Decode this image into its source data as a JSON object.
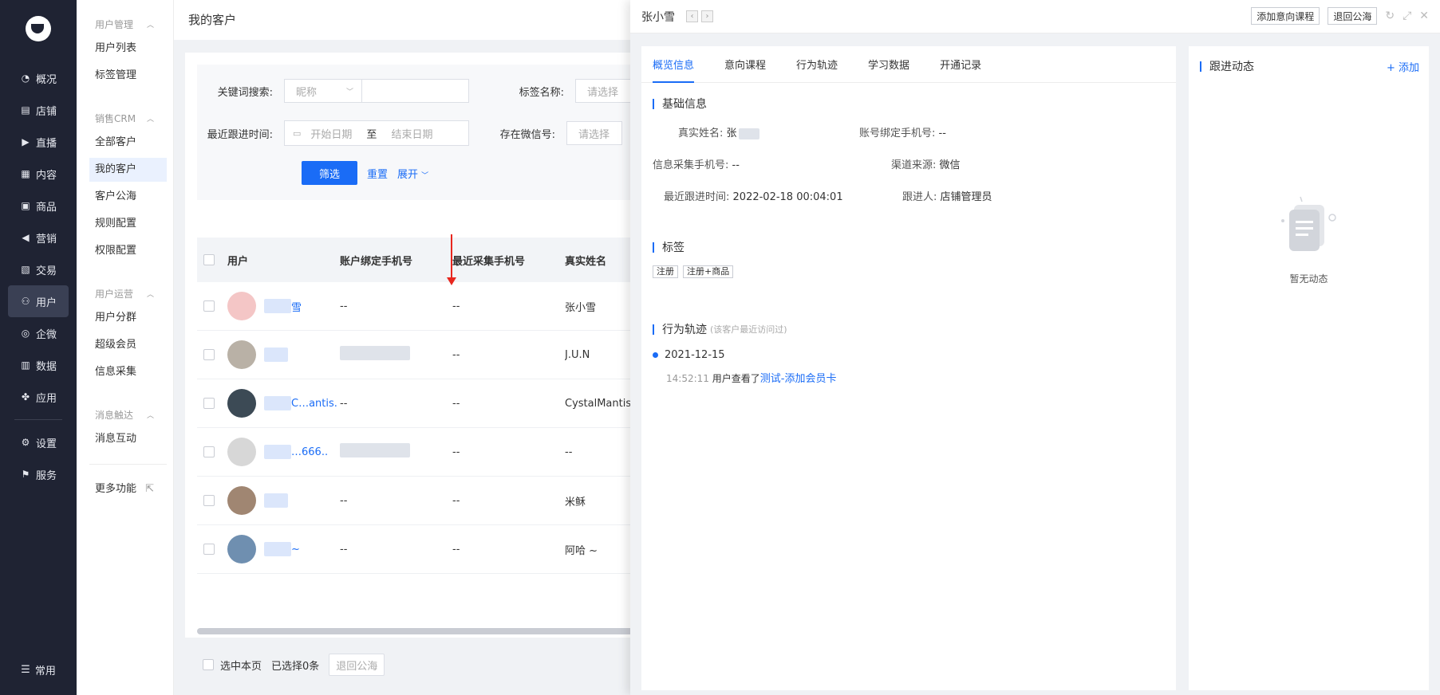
{
  "nav": {
    "items": [
      {
        "label": "概况",
        "icon": "dashboard-icon",
        "glyph": "◔"
      },
      {
        "label": "店铺",
        "icon": "store-icon",
        "glyph": "▤"
      },
      {
        "label": "直播",
        "icon": "live-icon",
        "glyph": "▶"
      },
      {
        "label": "内容",
        "icon": "content-icon",
        "glyph": "▦"
      },
      {
        "label": "商品",
        "icon": "goods-icon",
        "glyph": "▣"
      },
      {
        "label": "营销",
        "icon": "marketing-icon",
        "glyph": "◀"
      },
      {
        "label": "交易",
        "icon": "trade-icon",
        "glyph": "▧"
      },
      {
        "label": "用户",
        "icon": "user-icon",
        "glyph": "⚇"
      },
      {
        "label": "企微",
        "icon": "wecom-icon",
        "glyph": "◎"
      },
      {
        "label": "数据",
        "icon": "data-icon",
        "glyph": "▥"
      },
      {
        "label": "应用",
        "icon": "apps-icon",
        "glyph": "✤"
      }
    ],
    "items2": [
      {
        "label": "设置",
        "icon": "settings-icon",
        "glyph": "⚙"
      },
      {
        "label": "服务",
        "icon": "service-icon",
        "glyph": "⚑"
      }
    ],
    "bottom_label": "常用"
  },
  "sub": {
    "group1": "用户管理",
    "g1items": [
      "用户列表",
      "标签管理"
    ],
    "group2": "销售CRM",
    "g2items": [
      "全部客户",
      "我的客户",
      "客户公海",
      "规则配置",
      "权限配置"
    ],
    "group3": "用户运营",
    "g3items": [
      "用户分群",
      "超级会员",
      "信息采集"
    ],
    "group4": "消息触达",
    "g4items": [
      "消息互动"
    ],
    "more": "更多功能"
  },
  "page": {
    "title": "我的客户",
    "filter": {
      "keyword_label": "关键词搜索:",
      "keyword_select": "昵称",
      "tag_label": "标签名称:",
      "tag_placeholder": "请选择",
      "recent_label": "最近跟进时间:",
      "start_date": "开始日期",
      "to": "至",
      "end_date": "结束日期",
      "wechat_label": "存在微信号:",
      "wechat_placeholder": "请选择",
      "filter_btn": "筛选",
      "reset": "重置",
      "expand": "展开"
    },
    "table": {
      "headers": [
        "用户",
        "账户绑定手机号",
        "最近采集手机号",
        "真实姓名"
      ],
      "rows": [
        {
          "user": "雪",
          "phone": "--",
          "collect": "--",
          "name": "张小雪",
          "avatar": "#f4c6c6"
        },
        {
          "user": "",
          "phone": "",
          "collect": "--",
          "name": "J.U.N",
          "avatar": "#b9b1a6"
        },
        {
          "user": "C…antis.",
          "phone": "--",
          "collect": "--",
          "name": "CystalMantis",
          "avatar": "#3c4a55"
        },
        {
          "user": "…666..",
          "phone": "",
          "collect": "--",
          "name": "--",
          "avatar": "#d7d7d7"
        },
        {
          "user": "",
          "phone": "--",
          "collect": "--",
          "name": "米稣",
          "avatar": "#a08672"
        },
        {
          "user": "~",
          "phone": "--",
          "collect": "--",
          "name": "阿哈 ~",
          "avatar": "#6f8fb0"
        }
      ]
    },
    "footer": {
      "select_page": "选中本页",
      "selected": "已选择0条",
      "return_btn": "退回公海"
    }
  },
  "drawer": {
    "title": "张小雪",
    "prev": "‹",
    "next": "›",
    "add_course": "添加意向课程",
    "return_pool": "退回公海",
    "tabs": [
      "概览信息",
      "意向课程",
      "行为轨迹",
      "学习数据",
      "开通记录"
    ],
    "basic_title": "基础信息",
    "fields": {
      "real_name_label": "真实姓名:",
      "real_name": "张",
      "bind_phone_label": "账号绑定手机号:",
      "bind_phone": "--",
      "collect_phone_label": "信息采集手机号:",
      "collect_phone": "--",
      "channel_label": "渠道来源:",
      "channel": "微信",
      "recent_label": "最近跟进时间:",
      "recent": "2022-02-18 00:04:01",
      "follower_label": "跟进人:",
      "follower": "店铺管理员"
    },
    "tag_title": "标签",
    "tags": [
      "注册",
      "注册+商品"
    ],
    "track_title": "行为轨迹",
    "track_hint": "(该客户最近访问过)",
    "track_date": "2021-12-15",
    "track_time": "14:52:11",
    "track_text": "用户查看了",
    "track_link": "测试-添加会员卡",
    "follow_title": "跟进动态",
    "follow_add": "+ 添加",
    "empty_text": "暂无动态"
  }
}
